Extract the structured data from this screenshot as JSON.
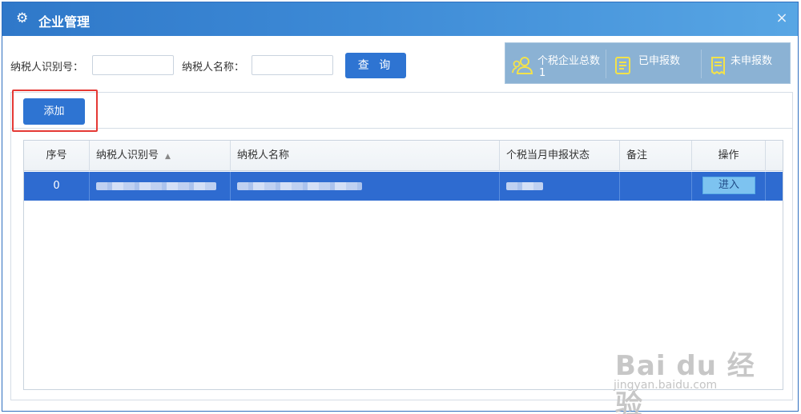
{
  "window": {
    "title": "企业管理",
    "title_icon": "gear-icon",
    "close_label": "×"
  },
  "search": {
    "taxpayer_id_label": "纳税人识别号：",
    "taxpayer_id_value": "",
    "taxpayer_name_label": "纳税人名称：",
    "taxpayer_name_value": "",
    "query_label": "查 询"
  },
  "stats": [
    {
      "icon": "users-icon",
      "label": "个税企业总数",
      "value": "1"
    },
    {
      "icon": "declared-doc-icon",
      "label": "已申报数",
      "value": ""
    },
    {
      "icon": "undeclared-receipt-icon",
      "label": "未申报数",
      "value": ""
    }
  ],
  "toolbar": {
    "add_label": "添加"
  },
  "table": {
    "columns": [
      "序号",
      "纳税人识别号",
      "纳税人名称",
      "个税当月申报状态",
      "备注",
      "操作"
    ],
    "sort_indicator": "▲",
    "rows": [
      {
        "index": "0",
        "taxpayer_id": "",
        "taxpayer_name": "",
        "status": "",
        "remark": "",
        "action": "进入"
      }
    ]
  },
  "watermark": {
    "main": "Bai du 经验",
    "sub": "jingyan.baidu.com"
  },
  "colors": {
    "title_bar": "#2f78c9",
    "primary_button": "#2e74d2",
    "selected_row": "#2e6bd0",
    "stats_panel": "#8bb2d4",
    "highlight": "#e53935",
    "enter_button": "#7dc3f0"
  }
}
